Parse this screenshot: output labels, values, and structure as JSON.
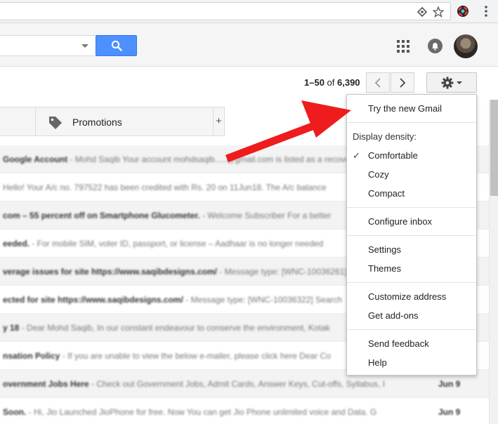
{
  "header": {
    "search_placeholder": ""
  },
  "toolbar": {
    "pager_range": "1–50",
    "pager_of": " of ",
    "pager_total": "6,390"
  },
  "tabs": {
    "promotions_label": "Promotions",
    "add_label": "+"
  },
  "settings_menu": {
    "try_new": "Try the new Gmail",
    "density_label": "Display density:",
    "density_options": [
      "Comfortable",
      "Cozy",
      "Compact"
    ],
    "selected_density": "Comfortable",
    "check_mark": "✓",
    "configure_inbox": "Configure inbox",
    "settings": "Settings",
    "themes": "Themes",
    "customize_address": "Customize address",
    "get_addons": "Get add-ons",
    "send_feedback": "Send feedback",
    "help": "Help"
  },
  "emails": [
    {
      "subject": "Google Account",
      "snippet": " - Mohd Saqib Your account mohdsaqib.....@gmail.com is listed as a recovery",
      "date": "",
      "read": true
    },
    {
      "subject": "",
      "snippet": "Hello! Your A/c no. 797522 has been credited with Rs. 20 on 11Jun18. The A/c balance",
      "date": "",
      "read": false
    },
    {
      "subject": "com – 55 percent off on Smartphone Glucometer.",
      "snippet": " - Welcome Subscriber For a better",
      "date": "",
      "read": true
    },
    {
      "subject": "eeded.",
      "snippet": " - For mobile SIM, voter ID, passport, or license – Aadhaar is no longer needed",
      "date": "",
      "read": false
    },
    {
      "subject": "verage issues for site https://www.saqibdesigns.com/",
      "snippet": " - Message type: [WNC-10036261]",
      "date": "",
      "read": true
    },
    {
      "subject": "ected for site https://www.saqibdesigns.com/",
      "snippet": " - Message type: [WNC-10036322] Search",
      "date": "",
      "read": false
    },
    {
      "subject": "y 18",
      "snippet": " - Dear Mohd Saqib, In our constant endeavour to conserve the environment, Kotak",
      "date": "",
      "read": true
    },
    {
      "subject": "nsation Policy",
      "snippet": " - If you are unable to view the below e-mailer, please click here Dear Co",
      "date": "",
      "read": false
    },
    {
      "subject": "overnment Jobs Here",
      "snippet": " - Check out Government Jobs, Admit Cards, Answer Keys, Cut-offs, Syllabus, I",
      "date": "Jun 9",
      "read": true
    },
    {
      "subject": " Soon.",
      "snippet": " - Hi, Jio Launched JioPhone for free. Now You can get Jio Phone unlimited voice and Data. G",
      "date": "Jun 9",
      "read": false
    }
  ],
  "colors": {
    "search_button": "#4d90fe",
    "annotation_arrow": "#ee1c1c"
  },
  "icons": [
    "password-key-icon",
    "star-icon",
    "chrome-profile-icon",
    "more-vert-icon",
    "search-icon",
    "apps-grid-icon",
    "notifications-icon",
    "avatar",
    "chevron-left-icon",
    "chevron-right-icon",
    "gear-icon",
    "tag-icon"
  ]
}
